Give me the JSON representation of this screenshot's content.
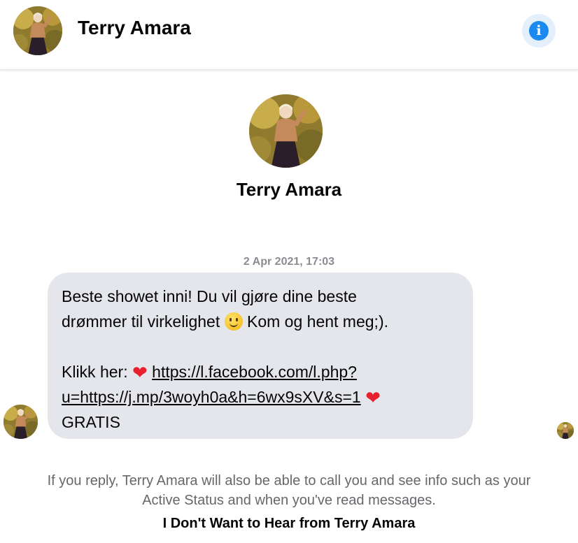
{
  "header": {
    "contact_name": "Terry Amara",
    "info_icon": "info-icon"
  },
  "profile": {
    "name": "Terry Amara"
  },
  "conversation": {
    "timestamp": "2 Apr 2021, 17:03",
    "message": {
      "line1": "Beste showet inni! Du vil gjøre dine beste",
      "line2_pre": "drømmer til virkelighet",
      "line2_post": "Kom og hent meg;).",
      "click_label": "Klikk her:",
      "link_part1": "https://l.facebook.com/l.php?",
      "link_part2": "u=https://j.mp/3woyh0a&h=6wx9sXV&s=1",
      "trailing": "GRATIS"
    },
    "emojis": [
      "smiling-face-icon",
      "red-heart-icon"
    ]
  },
  "footer": {
    "note_line1": "If you reply, Terry Amara will also be able to call you and see info such as your",
    "note_line2": "Active Status and when you've read messages.",
    "block_label": "I Don't Want to Hear from Terry Amara"
  },
  "colors": {
    "accent": "#1b8af0",
    "bubble": "#e4e6eb",
    "muted_text": "#65676b",
    "heart": "#e8202e"
  }
}
